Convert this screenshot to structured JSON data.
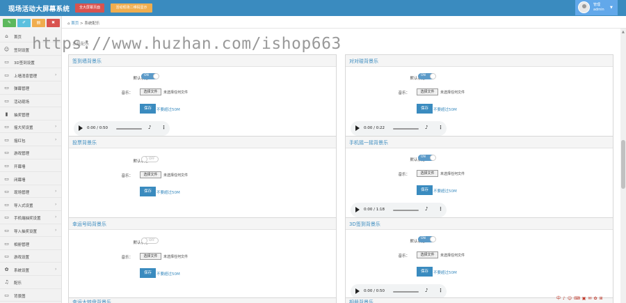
{
  "header": {
    "title": "现场活动大屏幕系统",
    "btn_open_screen": "全大屏幕页面",
    "btn_enter_mobile": "活动现场二维码显示",
    "user_role": "管理",
    "user_name": "admin"
  },
  "sidebar": {
    "quick_colors": [
      "#5cb85c",
      "#5bc0de",
      "#f0ad4e",
      "#d9534f"
    ],
    "items": [
      {
        "label": "首页",
        "icon": "home-icon",
        "glyph": "⌂",
        "has_children": false
      },
      {
        "label": "签到设置",
        "icon": "users-icon",
        "glyph": "☺",
        "has_children": false
      },
      {
        "label": "3D签到设置",
        "icon": "monitor-icon",
        "glyph": "▭",
        "has_children": false
      },
      {
        "label": "上墙消息管理",
        "icon": "monitor-icon",
        "glyph": "▭",
        "has_children": true
      },
      {
        "label": "弹幕管理",
        "icon": "monitor-icon",
        "glyph": "▭",
        "has_children": false
      },
      {
        "label": "活动现场",
        "icon": "monitor-icon",
        "glyph": "▭",
        "has_children": false
      },
      {
        "label": "抽奖管理",
        "icon": "chart-icon",
        "glyph": "▮",
        "has_children": false
      },
      {
        "label": "摇大奖设置",
        "icon": "monitor-icon",
        "glyph": "▭",
        "has_children": true
      },
      {
        "label": "摇红包",
        "icon": "monitor-icon",
        "glyph": "▭",
        "has_children": true
      },
      {
        "label": "游戏管理",
        "icon": "monitor-icon",
        "glyph": "▭",
        "has_children": false
      },
      {
        "label": "开幕墙",
        "icon": "monitor-icon",
        "glyph": "▭",
        "has_children": false
      },
      {
        "label": "闭幕墙",
        "icon": "monitor-icon",
        "glyph": "▭",
        "has_children": false
      },
      {
        "label": "现场管理",
        "icon": "monitor-icon",
        "glyph": "▭",
        "has_children": true
      },
      {
        "label": "导入式设置",
        "icon": "monitor-icon",
        "glyph": "▭",
        "has_children": true
      },
      {
        "label": "手机端抽奖设置",
        "icon": "monitor-icon",
        "glyph": "▭",
        "has_children": true
      },
      {
        "label": "导入抽奖设置",
        "icon": "monitor-icon",
        "glyph": "▭",
        "has_children": true
      },
      {
        "label": "相册管理",
        "icon": "monitor-icon",
        "glyph": "▭",
        "has_children": false
      },
      {
        "label": "游戏设置",
        "icon": "monitor-icon",
        "glyph": "▭",
        "has_children": false
      },
      {
        "label": "系统设置",
        "icon": "gear-icon",
        "glyph": "✿",
        "has_children": true
      },
      {
        "label": "配乐",
        "icon": "music-icon",
        "glyph": "♫",
        "has_children": false
      },
      {
        "label": "背景图",
        "icon": "monitor-icon",
        "glyph": "▭",
        "has_children": false
      }
    ]
  },
  "breadcrumb": {
    "home": "首页",
    "separator": ">",
    "current": "系统配乐"
  },
  "subtitle": "系统配乐",
  "watermark": "https://www.huzhan.com/ishop663",
  "common": {
    "label_default": "默认状态：",
    "label_music": "音乐：",
    "file_button": "选择文件",
    "no_file": "未选择任何文件",
    "save": "保存",
    "size_note": "不要超过50M",
    "toggle_on": "ON",
    "toggle_off": "OFF"
  },
  "panels": [
    {
      "title": "签到墙背景乐",
      "toggle": "on",
      "audio": true,
      "time": "0:00 / 0:50"
    },
    {
      "title": "对对碰背景乐",
      "toggle": "on",
      "audio": true,
      "time": "0:00 / 0:22"
    },
    {
      "title": "投票背景乐",
      "toggle": "off",
      "audio": false,
      "time": ""
    },
    {
      "title": "手机摇一摇背景乐",
      "toggle": "on",
      "audio": true,
      "time": "0:00 / 1:18"
    },
    {
      "title": "幸运号码背景乐",
      "toggle": "off",
      "audio": false,
      "time": ""
    },
    {
      "title": "3D签到背景乐",
      "toggle": "on",
      "audio": true,
      "time": "0:00 / 0:50"
    }
  ],
  "bottom_panels": [
    "幸运大转盘背景乐",
    "相册背景乐"
  ],
  "tray": [
    "中",
    "♪",
    "☺",
    "⌨",
    "▣",
    "✉",
    "✿",
    "⊞"
  ]
}
